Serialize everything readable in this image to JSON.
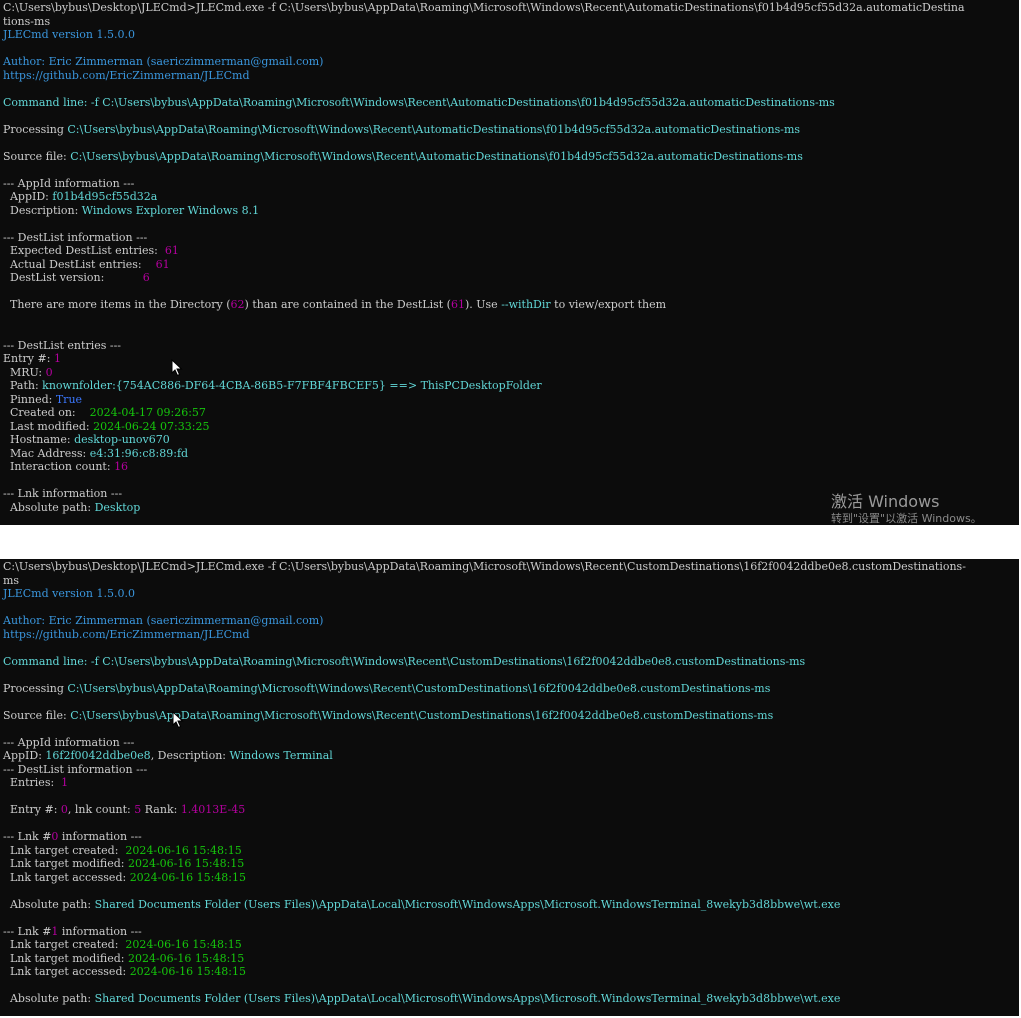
{
  "top": {
    "lines": [
      [
        {
          "t": "C:\\Users\\bybus\\Desktop\\JLECmd>JLECmd.exe -f C:\\Users\\bybus\\AppData\\Roaming\\Microsoft\\Windows\\Recent\\AutomaticDestinations\\f01b4d95cf55d32a.automaticDestina",
          "c": "default"
        }
      ],
      [
        {
          "t": "tions-ms",
          "c": "default"
        }
      ],
      [
        {
          "t": "JLECmd version 1.5.0.0",
          "c": "cyan"
        }
      ],
      [
        {
          "t": "",
          "c": "default"
        }
      ],
      [
        {
          "t": "Author: Eric Zimmerman (saericzimmerman@gmail.com)",
          "c": "cyan"
        }
      ],
      [
        {
          "t": "https://github.com/EricZimmerman/JLECmd",
          "c": "cyan"
        }
      ],
      [
        {
          "t": "",
          "c": "default"
        }
      ],
      [
        {
          "t": "Command line: -f C:\\Users\\bybus\\AppData\\Roaming\\Microsoft\\Windows\\Recent\\AutomaticDestinations\\f01b4d95cf55d32a.automaticDestinations-ms",
          "c": "teal"
        }
      ],
      [
        {
          "t": "",
          "c": "default"
        }
      ],
      [
        {
          "t": "Processing ",
          "c": "default"
        },
        {
          "t": "C:\\Users\\bybus\\AppData\\Roaming\\Microsoft\\Windows\\Recent\\AutomaticDestinations\\f01b4d95cf55d32a.automaticDestinations-ms",
          "c": "teal"
        }
      ],
      [
        {
          "t": "",
          "c": "default"
        }
      ],
      [
        {
          "t": "Source file: ",
          "c": "default"
        },
        {
          "t": "C:\\Users\\bybus\\AppData\\Roaming\\Microsoft\\Windows\\Recent\\AutomaticDestinations\\f01b4d95cf55d32a.automaticDestinations-ms",
          "c": "teal"
        }
      ],
      [
        {
          "t": "",
          "c": "default"
        }
      ],
      [
        {
          "t": "--- AppId information ---",
          "c": "default"
        }
      ],
      [
        {
          "t": "  AppID: ",
          "c": "default"
        },
        {
          "t": "f01b4d95cf55d32a",
          "c": "teal"
        }
      ],
      [
        {
          "t": "  Description: ",
          "c": "default"
        },
        {
          "t": "Windows Explorer Windows 8.1",
          "c": "teal"
        }
      ],
      [
        {
          "t": "",
          "c": "default"
        }
      ],
      [
        {
          "t": "--- DestList information ---",
          "c": "default"
        }
      ],
      [
        {
          "t": "  Expected DestList entries:  ",
          "c": "default"
        },
        {
          "t": "61",
          "c": "mag"
        }
      ],
      [
        {
          "t": "  Actual DestList entries:    ",
          "c": "default"
        },
        {
          "t": "61",
          "c": "mag"
        }
      ],
      [
        {
          "t": "  DestList version:           ",
          "c": "default"
        },
        {
          "t": "6",
          "c": "mag"
        }
      ],
      [
        {
          "t": "",
          "c": "default"
        }
      ],
      [
        {
          "t": "  There are more items in the Directory (",
          "c": "default"
        },
        {
          "t": "62",
          "c": "mag"
        },
        {
          "t": ") than are contained in the DestList (",
          "c": "default"
        },
        {
          "t": "61",
          "c": "mag"
        },
        {
          "t": "). Use ",
          "c": "default"
        },
        {
          "t": "--withDir",
          "c": "teal"
        },
        {
          "t": " to view/export them",
          "c": "default"
        }
      ],
      [
        {
          "t": "",
          "c": "default"
        }
      ],
      [
        {
          "t": "",
          "c": "default"
        }
      ],
      [
        {
          "t": "--- DestList entries ---",
          "c": "default"
        }
      ],
      [
        {
          "t": "Entry #: ",
          "c": "default"
        },
        {
          "t": "1",
          "c": "mag"
        }
      ],
      [
        {
          "t": "  MRU: ",
          "c": "default"
        },
        {
          "t": "0",
          "c": "mag"
        }
      ],
      [
        {
          "t": "  Path: ",
          "c": "default"
        },
        {
          "t": "knownfolder:{754AC886-DF64-4CBA-86B5-F7FBF4FBCEF5} ==> ThisPCDesktopFolder",
          "c": "teal"
        }
      ],
      [
        {
          "t": "  Pinned: ",
          "c": "default"
        },
        {
          "t": "True",
          "c": "blue"
        }
      ],
      [
        {
          "t": "  Created on:    ",
          "c": "default"
        },
        {
          "t": "2024-04-17 09:26:57",
          "c": "green"
        }
      ],
      [
        {
          "t": "  Last modified: ",
          "c": "default"
        },
        {
          "t": "2024-06-24 07:33:25",
          "c": "green"
        }
      ],
      [
        {
          "t": "  Hostname: ",
          "c": "default"
        },
        {
          "t": "desktop-unov670",
          "c": "teal"
        }
      ],
      [
        {
          "t": "  Mac Address: ",
          "c": "default"
        },
        {
          "t": "e4:31:96:c8:89:fd",
          "c": "teal"
        }
      ],
      [
        {
          "t": "  Interaction count: ",
          "c": "default"
        },
        {
          "t": "16",
          "c": "mag"
        }
      ],
      [
        {
          "t": "",
          "c": "default"
        }
      ],
      [
        {
          "t": "--- Lnk information ---",
          "c": "default"
        }
      ],
      [
        {
          "t": "  Absolute path: ",
          "c": "default"
        },
        {
          "t": "Desktop",
          "c": "teal"
        }
      ]
    ],
    "watermark_title": "激活 Windows",
    "watermark_sub": "转到\"设置\"以激活 Windows。"
  },
  "bottom": {
    "lines": [
      [
        {
          "t": "C:\\Users\\bybus\\Desktop\\JLECmd>JLECmd.exe -f C:\\Users\\bybus\\AppData\\Roaming\\Microsoft\\Windows\\Recent\\CustomDestinations\\16f2f0042ddbe0e8.customDestinations-",
          "c": "default"
        }
      ],
      [
        {
          "t": "ms",
          "c": "default"
        }
      ],
      [
        {
          "t": "JLECmd version 1.5.0.0",
          "c": "cyan"
        }
      ],
      [
        {
          "t": "",
          "c": "default"
        }
      ],
      [
        {
          "t": "Author: Eric Zimmerman (saericzimmerman@gmail.com)",
          "c": "cyan"
        }
      ],
      [
        {
          "t": "https://github.com/EricZimmerman/JLECmd",
          "c": "cyan"
        }
      ],
      [
        {
          "t": "",
          "c": "default"
        }
      ],
      [
        {
          "t": "Command line: -f C:\\Users\\bybus\\AppData\\Roaming\\Microsoft\\Windows\\Recent\\CustomDestinations\\16f2f0042ddbe0e8.customDestinations-ms",
          "c": "teal"
        }
      ],
      [
        {
          "t": "",
          "c": "default"
        }
      ],
      [
        {
          "t": "Processing ",
          "c": "default"
        },
        {
          "t": "C:\\Users\\bybus\\AppData\\Roaming\\Microsoft\\Windows\\Recent\\CustomDestinations\\16f2f0042ddbe0e8.customDestinations-ms",
          "c": "teal"
        }
      ],
      [
        {
          "t": "",
          "c": "default"
        }
      ],
      [
        {
          "t": "Source file: ",
          "c": "default"
        },
        {
          "t": "C:\\Users\\bybus\\AppData\\Roaming\\Microsoft\\Windows\\Recent\\CustomDestinations\\16f2f0042ddbe0e8.customDestinations-ms",
          "c": "teal"
        }
      ],
      [
        {
          "t": "",
          "c": "default"
        }
      ],
      [
        {
          "t": "--- AppId information ---",
          "c": "default"
        }
      ],
      [
        {
          "t": "AppID: ",
          "c": "default"
        },
        {
          "t": "16f2f0042ddbe0e8",
          "c": "teal"
        },
        {
          "t": ", Description: ",
          "c": "default"
        },
        {
          "t": "Windows Terminal",
          "c": "teal"
        }
      ],
      [
        {
          "t": "--- DestList information ---",
          "c": "default"
        }
      ],
      [
        {
          "t": "  Entries:  ",
          "c": "default"
        },
        {
          "t": "1",
          "c": "mag"
        }
      ],
      [
        {
          "t": "",
          "c": "default"
        }
      ],
      [
        {
          "t": "  Entry #: ",
          "c": "default"
        },
        {
          "t": "0",
          "c": "mag"
        },
        {
          "t": ", lnk count: ",
          "c": "default"
        },
        {
          "t": "5",
          "c": "mag"
        },
        {
          "t": " Rank: ",
          "c": "default"
        },
        {
          "t": "1.4013E-45",
          "c": "mag"
        }
      ],
      [
        {
          "t": "",
          "c": "default"
        }
      ],
      [
        {
          "t": "--- Lnk #",
          "c": "default"
        },
        {
          "t": "0",
          "c": "mag"
        },
        {
          "t": " information ---",
          "c": "default"
        }
      ],
      [
        {
          "t": "  Lnk target created:  ",
          "c": "default"
        },
        {
          "t": "2024-06-16 15:48:15",
          "c": "green"
        }
      ],
      [
        {
          "t": "  Lnk target modified: ",
          "c": "default"
        },
        {
          "t": "2024-06-16 15:48:15",
          "c": "green"
        }
      ],
      [
        {
          "t": "  Lnk target accessed: ",
          "c": "default"
        },
        {
          "t": "2024-06-16 15:48:15",
          "c": "green"
        }
      ],
      [
        {
          "t": "",
          "c": "default"
        }
      ],
      [
        {
          "t": "  Absolute path: ",
          "c": "default"
        },
        {
          "t": "Shared Documents Folder (Users Files)\\AppData\\Local\\Microsoft\\WindowsApps\\Microsoft.WindowsTerminal_8wekyb3d8bbwe\\wt.exe",
          "c": "teal"
        }
      ],
      [
        {
          "t": "",
          "c": "default"
        }
      ],
      [
        {
          "t": "--- Lnk #",
          "c": "default"
        },
        {
          "t": "1",
          "c": "mag"
        },
        {
          "t": " information ---",
          "c": "default"
        }
      ],
      [
        {
          "t": "  Lnk target created:  ",
          "c": "default"
        },
        {
          "t": "2024-06-16 15:48:15",
          "c": "green"
        }
      ],
      [
        {
          "t": "  Lnk target modified: ",
          "c": "default"
        },
        {
          "t": "2024-06-16 15:48:15",
          "c": "green"
        }
      ],
      [
        {
          "t": "  Lnk target accessed: ",
          "c": "default"
        },
        {
          "t": "2024-06-16 15:48:15",
          "c": "green"
        }
      ],
      [
        {
          "t": "",
          "c": "default"
        }
      ],
      [
        {
          "t": "  Absolute path: ",
          "c": "default"
        },
        {
          "t": "Shared Documents Folder (Users Files)\\AppData\\Local\\Microsoft\\WindowsApps\\Microsoft.WindowsTerminal_8wekyb3d8bbwe\\wt.exe",
          "c": "teal"
        }
      ]
    ]
  },
  "colors": {
    "background": "#0c0c0c",
    "default": "#cccccc",
    "cyan": "#3a96dd",
    "teal": "#61d6d6",
    "mag": "#b4009e",
    "green": "#16c60c",
    "blue": "#3b78ff"
  },
  "icons": {
    "pointer": "mouse-pointer-icon"
  }
}
